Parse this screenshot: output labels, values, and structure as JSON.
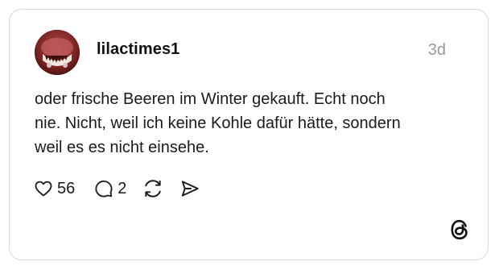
{
  "post": {
    "username": "lilactimes1",
    "time": "3d",
    "text_lines": [
      "oder frische Beeren im Winter gekauft. Echt noch",
      "nie. Nicht, weil ich keine Kohle dafür hätte, sondern",
      "weil es es nicht einsehe."
    ],
    "likes": "56",
    "replies": "2"
  },
  "icons": {
    "like": "heart-icon",
    "reply": "comment-bubble-icon",
    "repost": "repost-icon",
    "share": "send-icon",
    "brand": "threads-logo-icon"
  },
  "colors": {
    "text": "#1a1a1a",
    "muted": "#9a9a9a",
    "border": "#d9d9d9"
  }
}
